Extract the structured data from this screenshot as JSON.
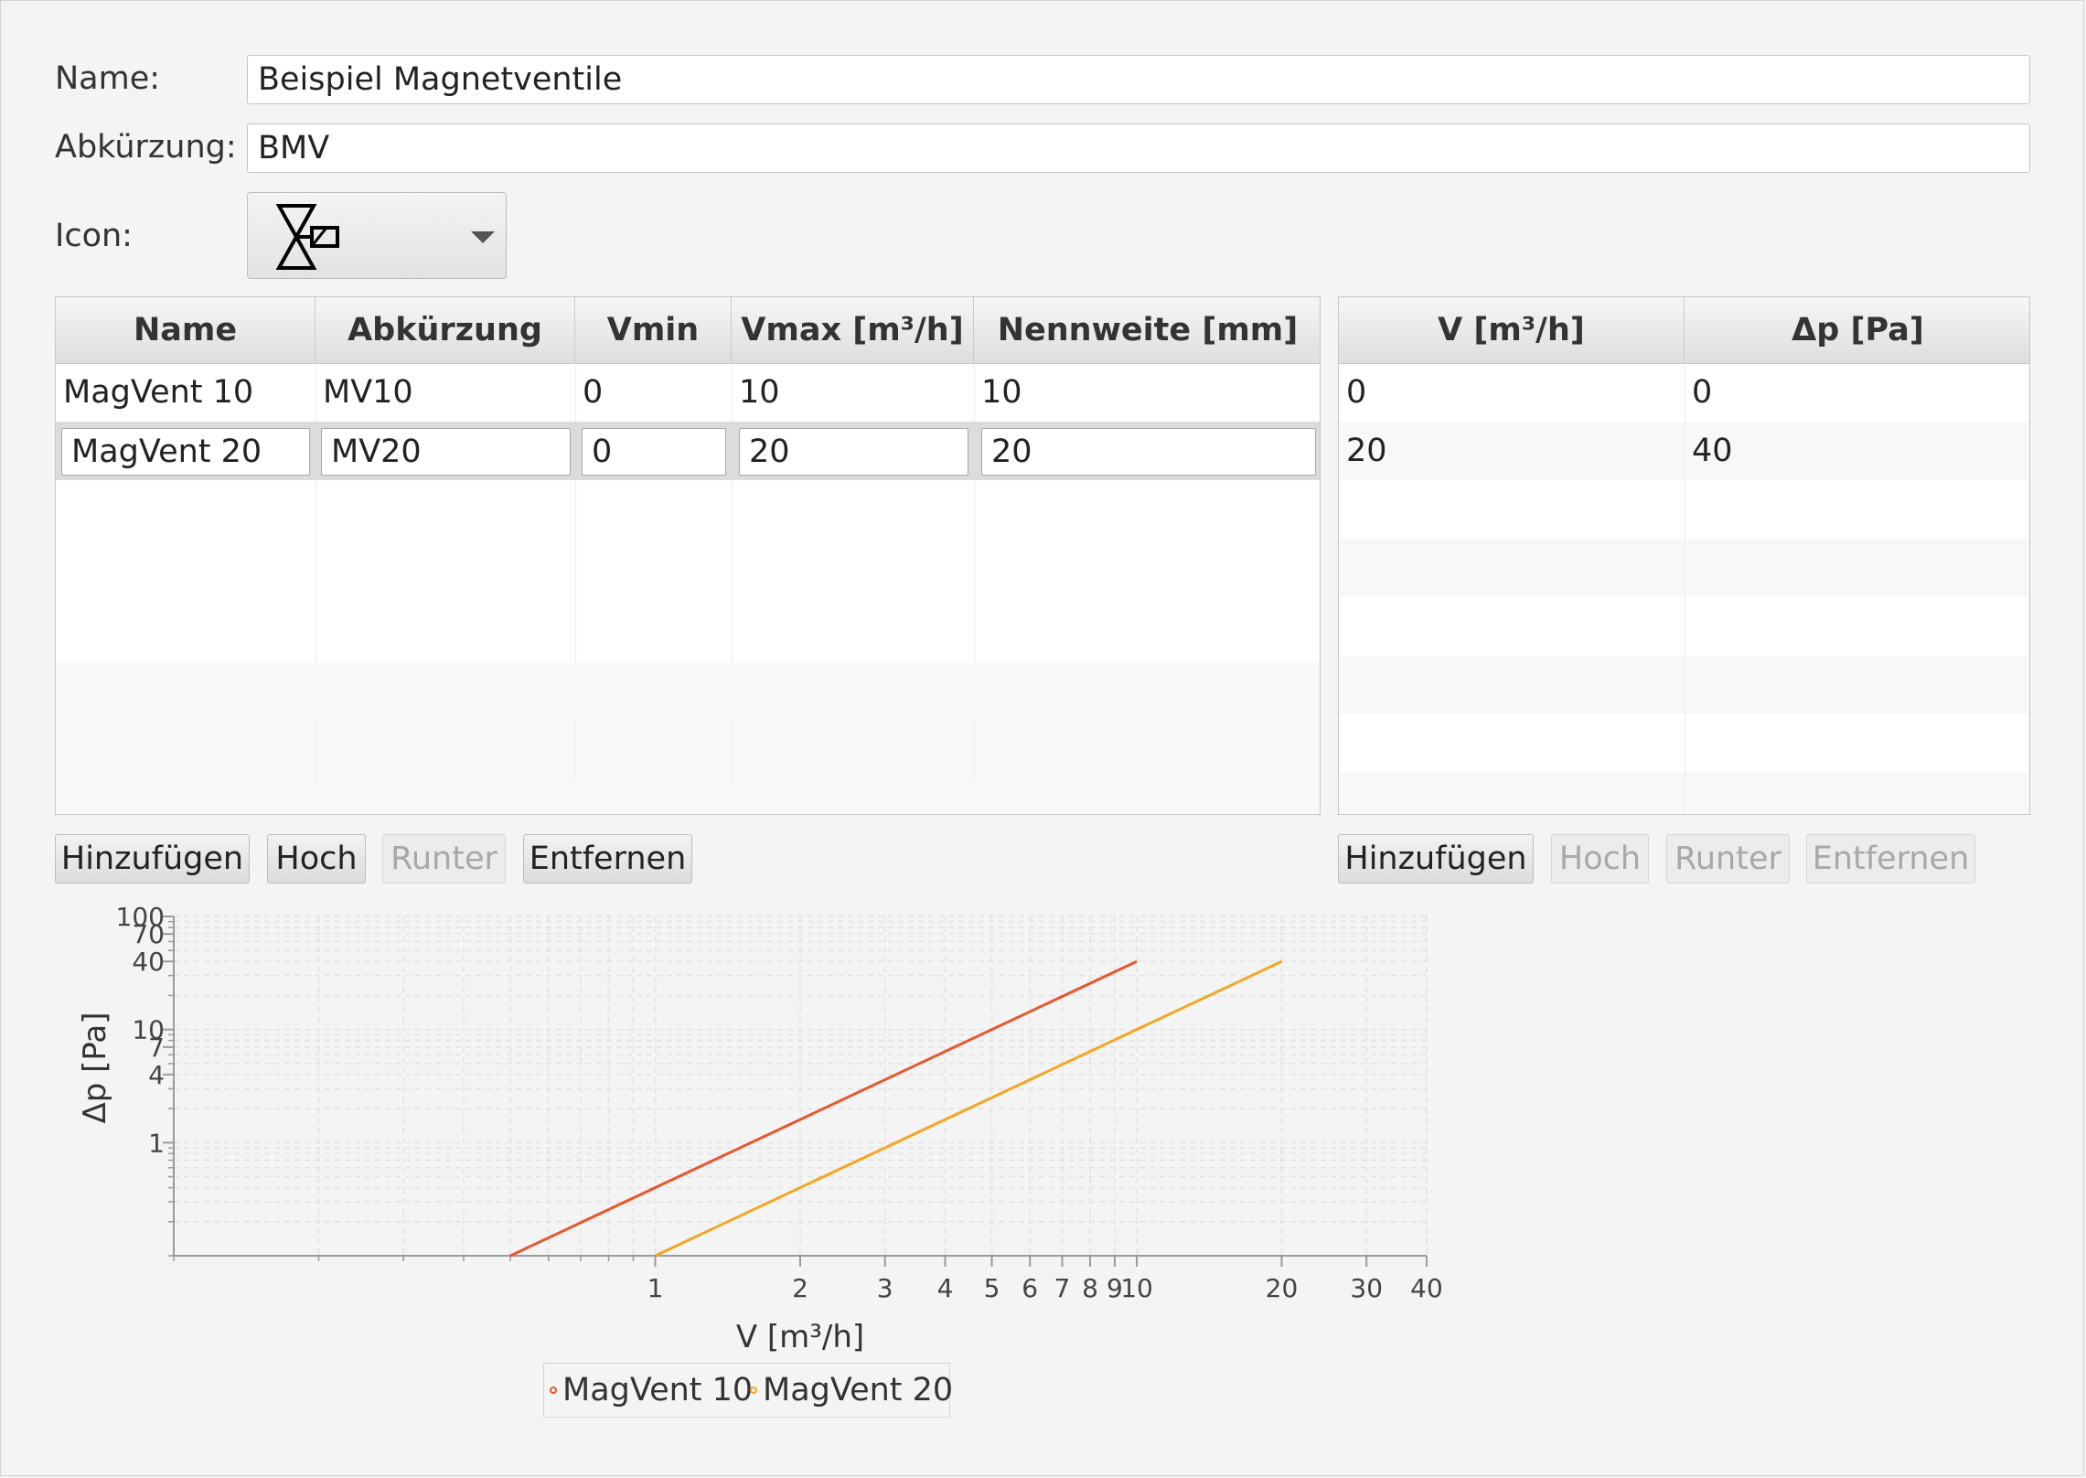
{
  "form": {
    "name_label": "Name:",
    "name_value": "Beispiel Magnetventile",
    "abbr_label": "Abkürzung:",
    "abbr_value": "BMV",
    "icon_label": "Icon:",
    "icon_name": "magnet-valve-icon"
  },
  "valves_table": {
    "headers": [
      "Name",
      "Abkürzung",
      "Vmin",
      "Vmax [m³/h]",
      "Nennweite [mm]"
    ],
    "rows": [
      [
        "MagVent 10",
        "MV10",
        "0",
        "10",
        "10"
      ],
      [
        "MagVent 20",
        "MV20",
        "0",
        "20",
        "20"
      ]
    ],
    "selected_row": 1
  },
  "points_table": {
    "headers": [
      "V [m³/h]",
      "Δp [Pa]"
    ],
    "rows": [
      [
        "0",
        "0"
      ],
      [
        "20",
        "40"
      ]
    ]
  },
  "left_buttons": [
    {
      "label": "Hinzufügen",
      "enabled": true
    },
    {
      "label": "Hoch",
      "enabled": true
    },
    {
      "label": "Runter",
      "enabled": false
    },
    {
      "label": "Entfernen",
      "enabled": true
    }
  ],
  "right_buttons": [
    {
      "label": "Hinzufügen",
      "enabled": true
    },
    {
      "label": "Hoch",
      "enabled": false
    },
    {
      "label": "Runter",
      "enabled": false
    },
    {
      "label": "Entfernen",
      "enabled": false
    }
  ],
  "chart_data": {
    "type": "line",
    "xlabel": "V [m³/h]",
    "ylabel": "Δp [Pa]",
    "x_scale": "log",
    "y_scale": "log",
    "xlim": [
      0.1,
      40
    ],
    "ylim": [
      0.1,
      100
    ],
    "x_ticks": [
      1,
      2,
      3,
      4,
      5,
      6,
      7,
      8,
      9,
      10,
      20,
      30,
      40
    ],
    "y_ticks": [
      1,
      4,
      7,
      10,
      40,
      70,
      100
    ],
    "grid": true,
    "legend_position": "bottom",
    "series": [
      {
        "name": "MagVent 10",
        "color": "#e8572e",
        "x": [
          0.5,
          10
        ],
        "y": [
          0.1,
          40
        ]
      },
      {
        "name": "MagVent 20",
        "color": "#f4a623",
        "x": [
          1,
          20
        ],
        "y": [
          0.1,
          40
        ]
      }
    ]
  }
}
